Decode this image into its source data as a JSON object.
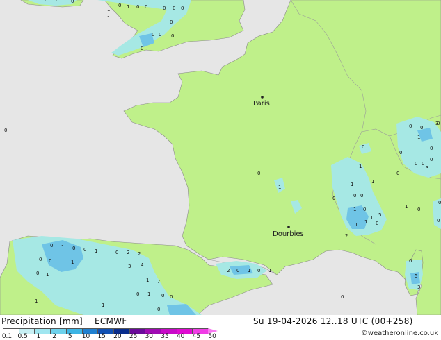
{
  "map": {
    "places": [
      {
        "name": "Paris"
      },
      {
        "name": "Dourbies"
      }
    ],
    "colors": {
      "sea": "#e6e6e6",
      "land": "#bff08a",
      "precip_light": "#a6e8e4",
      "precip_medium": "#6fc4e6",
      "border": "#9a9a9a"
    },
    "precip_values": [
      "0",
      "0",
      "0",
      "1",
      "0",
      "1",
      "0",
      "0",
      "0",
      "0",
      "0",
      "0",
      "1",
      "0",
      "0",
      "0",
      "0",
      "0",
      "0",
      "1",
      "0",
      "0",
      "0",
      "0",
      "0",
      "0",
      "1",
      "0",
      "0",
      "0",
      "1",
      "1",
      "0",
      "0",
      "0",
      "1",
      "0",
      "2",
      "1",
      "0",
      "1",
      "1",
      "0",
      "0",
      "0",
      "1",
      "0",
      "0",
      "1",
      "0",
      "0",
      "1",
      "0",
      "2",
      "2",
      "3",
      "4",
      "0",
      "1",
      "1",
      "7",
      "0",
      "1",
      "0",
      "0",
      "1",
      "1",
      "0",
      "1",
      "1",
      "1",
      "2",
      "0",
      "1",
      "0",
      "1",
      "0",
      "0",
      "5",
      "3",
      "0",
      "3",
      "3",
      "0",
      "1",
      "5",
      "1",
      "0"
    ]
  },
  "legend": {
    "title": "Precipitation [mm]",
    "model": "ECMWF",
    "datetime": "Su 19-04-2026 12..18 UTC (00+258)",
    "credit": "©weatheronline.co.uk",
    "ticks": [
      "0.1",
      "0.5",
      "1",
      "2",
      "5",
      "10",
      "15",
      "20",
      "25",
      "30",
      "35",
      "40",
      "45",
      "50"
    ],
    "colors": [
      "#ffffff",
      "#c8f0f4",
      "#a0e6f0",
      "#6ed2ec",
      "#3cb4e4",
      "#2080d0",
      "#1050b4",
      "#082c8c",
      "#6a0a9a",
      "#a00ab4",
      "#c80ac8",
      "#e00ad2",
      "#f03ce6",
      "#f878f0"
    ]
  }
}
